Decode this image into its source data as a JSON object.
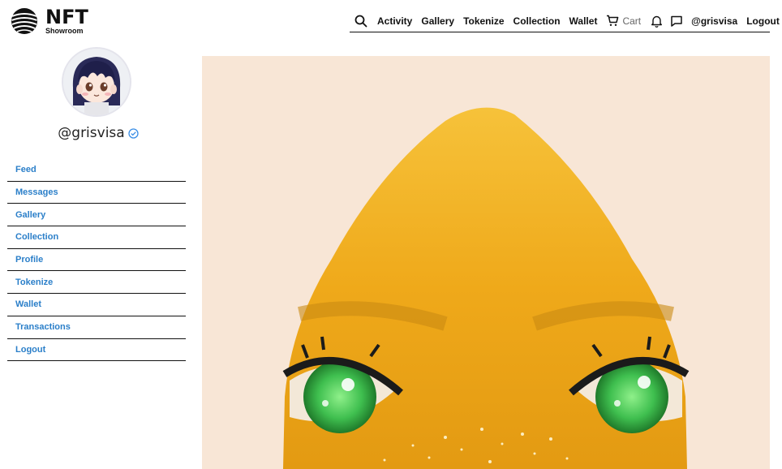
{
  "logo": {
    "title": "NFT",
    "subtitle": "Showroom"
  },
  "topnav": {
    "links": [
      "Activity",
      "Gallery",
      "Tokenize",
      "Collection",
      "Wallet"
    ],
    "cart_label": "Cart",
    "user": "@grisvisa",
    "logout": "Logout"
  },
  "profile": {
    "handle": "@grisvisa"
  },
  "sidebar": {
    "items": [
      "Feed",
      "Messages",
      "Gallery",
      "Collection",
      "Profile",
      "Tokenize",
      "Wallet",
      "Transactions",
      "Logout"
    ]
  },
  "colors": {
    "link_blue": "#2b7fc9",
    "verified_blue": "#3a8ee6",
    "art_bg": "#f8e6d6",
    "art_gold": "#f2b21c",
    "eye_green": "#3fbf4f"
  }
}
